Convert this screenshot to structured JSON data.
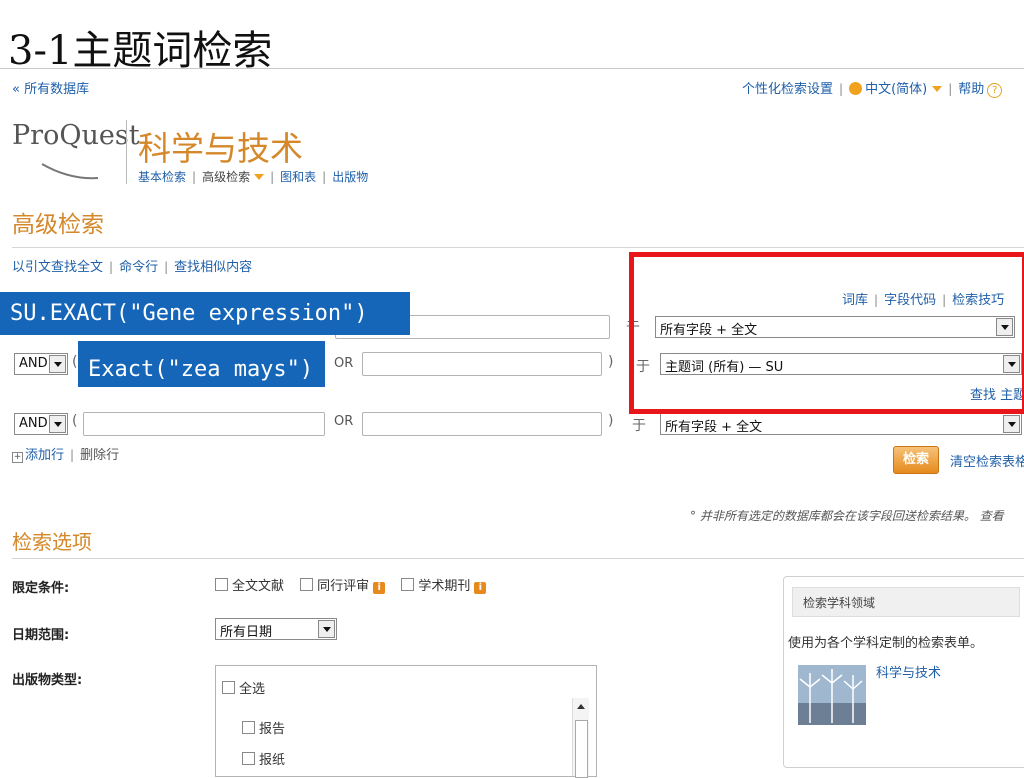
{
  "slide_title": "3-1主题词检索",
  "top_nav": {
    "all_databases": "« 所有数据库",
    "personal_settings": "个性化检索设置",
    "language": "中文(简体)",
    "help": "帮助"
  },
  "brand": {
    "logo": "ProQuest",
    "product": "科学与技术",
    "nav": [
      "基本检索",
      "高级检索",
      "图和表",
      "出版物"
    ]
  },
  "page_heading": "高级检索",
  "search_links": [
    "以引文查找全文",
    "命令行",
    "查找相似内容"
  ],
  "right_links": [
    "词库",
    "字段代码",
    "检索技巧"
  ],
  "find_topic": "查找 主题",
  "annotations": {
    "su_exact": "SU.EXACT(\"Gene expression\")",
    "exact_zea": "Exact(\"zea mays\")"
  },
  "rows": [
    {
      "operator": "",
      "field": "所有字段 + 全文"
    },
    {
      "operator": "AND",
      "or": "OR",
      "in": "于",
      "field": "主题词 (所有) — SU"
    },
    {
      "operator": "AND",
      "or": "OR",
      "in": "于",
      "field": "所有字段 + 全文"
    }
  ],
  "add_row": "添加行",
  "delete_row": "删除行",
  "search_button": "检索",
  "clear_form": "清空检索表格",
  "note": "° 并非所有选定的数据库都会在该字段回送检索结果。 查看",
  "options_heading": "检索选项",
  "limit_label": "限定条件:",
  "limits": [
    "全文文献",
    "同行评审",
    "学术期刊"
  ],
  "date_label": "日期范围:",
  "date_value": "所有日期",
  "pubtype_label": "出版物类型:",
  "pubtypes": [
    "全选",
    "报告",
    "报纸"
  ],
  "subject_box": {
    "title": "检索学科领域",
    "desc": "使用为各个学科定制的检索表单。",
    "link": "科学与技术"
  },
  "colors": {
    "accent": "#d4882a",
    "link": "#1f5fa8",
    "highlight": "#e8151b",
    "label_bg": "#1566b8"
  }
}
